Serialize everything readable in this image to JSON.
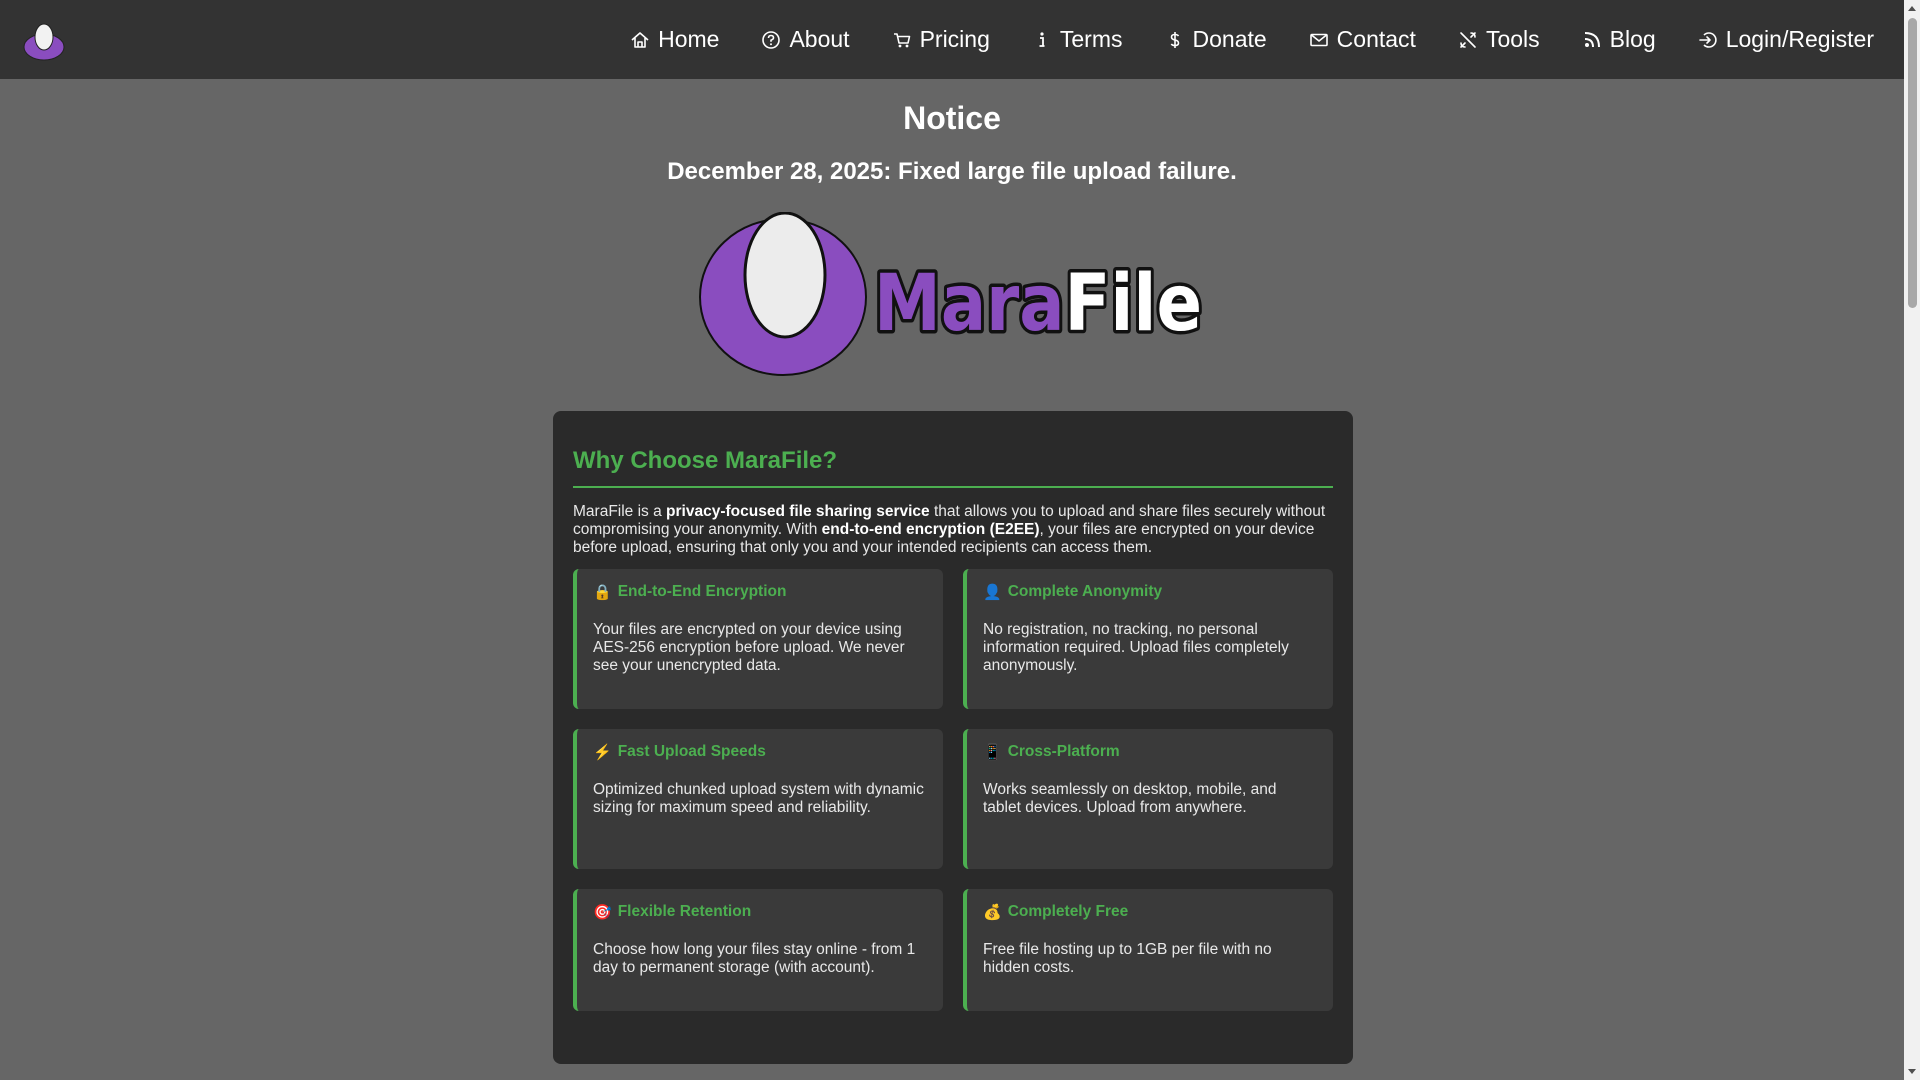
{
  "nav": {
    "logo_name": "MaraFile",
    "links": [
      {
        "label": "Home",
        "icon": "home-icon"
      },
      {
        "label": "About",
        "icon": "question-circle-icon"
      },
      {
        "label": "Pricing",
        "icon": "cart-icon"
      },
      {
        "label": "Terms",
        "icon": "info-icon"
      },
      {
        "label": "Donate",
        "icon": "dollar-icon"
      },
      {
        "label": "Contact",
        "icon": "envelope-icon"
      },
      {
        "label": "Tools",
        "icon": "tools-icon"
      },
      {
        "label": "Blog",
        "icon": "rss-icon"
      },
      {
        "label": "Login/Register",
        "icon": "login-icon"
      }
    ]
  },
  "notice": {
    "title": "Notice",
    "text": "December 28, 2025: Fixed large file upload failure."
  },
  "hero": {
    "brand_part1": "Mara",
    "brand_part2": "File",
    "colors": {
      "purple": "#8a4dbf",
      "white": "#ffffff",
      "outline": "#111111"
    }
  },
  "info": {
    "heading": "Why Choose MaraFile?",
    "intro": {
      "p1": "MaraFile is a ",
      "b1": "privacy-focused file sharing service",
      "p2": " that allows you to upload and share files securely without compromising your anonymity. With ",
      "b2": "end-to-end encryption (E2EE)",
      "p3": ", your files are encrypted on your device before upload, ensuring that only you and your intended recipients can access them."
    },
    "features": [
      {
        "emoji": "🔒",
        "icon": "lock-icon",
        "title": "End-to-End Encryption",
        "desc": "Your files are encrypted on your device using AES-256 encryption before upload. We never see your unencrypted data."
      },
      {
        "emoji": "👤",
        "icon": "user-icon",
        "title": "Complete Anonymity",
        "desc": "No registration, no tracking, no personal information required. Upload files completely anonymously."
      },
      {
        "emoji": "⚡",
        "icon": "lightning-icon",
        "title": "Fast Upload Speeds",
        "desc": "Optimized chunked upload system with dynamic sizing for maximum speed and reliability."
      },
      {
        "emoji": "📱",
        "icon": "mobile-icon",
        "title": "Cross-Platform",
        "desc": "Works seamlessly on desktop, mobile, and tablet devices. Upload from anywhere."
      },
      {
        "emoji": "🎯",
        "icon": "target-icon",
        "title": "Flexible Retention",
        "desc": "Choose how long your files stay online - from 1 day to permanent storage (with account)."
      },
      {
        "emoji": "💰",
        "icon": "money-bag-icon",
        "title": "Completely Free",
        "desc": "Free file hosting up to 1GB per file with no hidden costs."
      }
    ]
  },
  "theme": {
    "page_bg": "#666666",
    "nav_bg": "#333333",
    "card_bg": "#2a2a2a",
    "feature_bg": "#3a3a3a",
    "accent": "#4caf50"
  }
}
